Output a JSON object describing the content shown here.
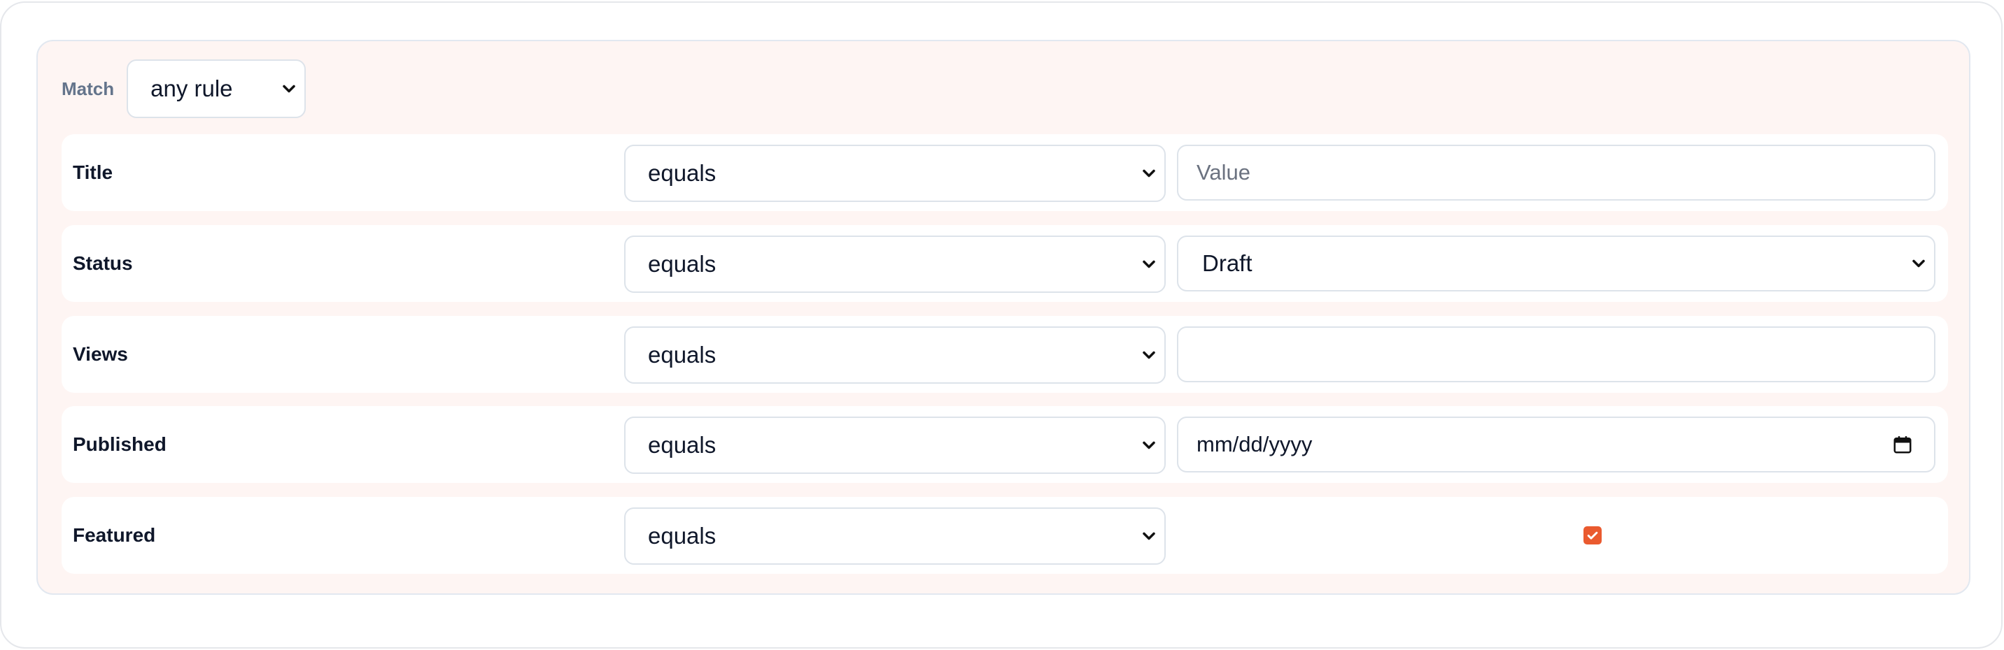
{
  "match": {
    "label": "Match",
    "selected": "any rule"
  },
  "rules": [
    {
      "field": "Title",
      "operator": "equals",
      "value_type": "text",
      "value": "",
      "placeholder": "Value"
    },
    {
      "field": "Status",
      "operator": "equals",
      "value_type": "select",
      "value": "Draft"
    },
    {
      "field": "Views",
      "operator": "equals",
      "value_type": "number",
      "value": ""
    },
    {
      "field": "Published",
      "operator": "equals",
      "value_type": "date",
      "value": "mm/dd/yyyy"
    },
    {
      "field": "Featured",
      "operator": "equals",
      "value_type": "checkbox",
      "checked": true
    }
  ],
  "colors": {
    "panel_bg": "#fef5f3",
    "accent": "#ea5a2f",
    "border": "#dde3ea"
  },
  "icons": {
    "select_chevron": "chevron-down-icon",
    "date_picker": "calendar-icon",
    "checkbox_check": "check-icon"
  }
}
